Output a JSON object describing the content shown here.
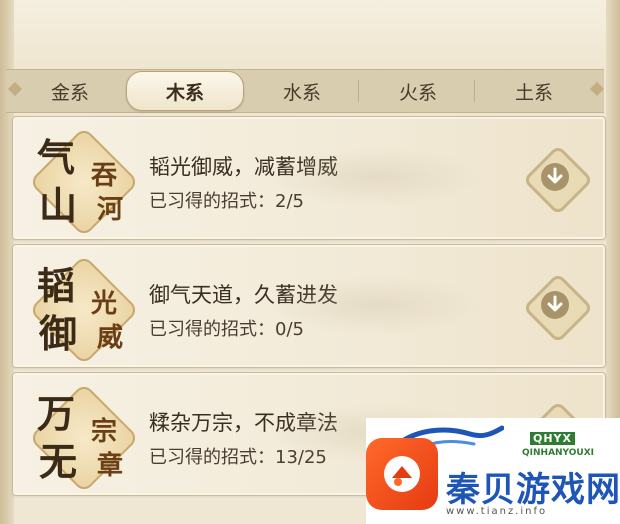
{
  "tabs": [
    {
      "label": "金系",
      "active": false
    },
    {
      "label": "木系",
      "active": true
    },
    {
      "label": "水系",
      "active": false
    },
    {
      "label": "火系",
      "active": false
    },
    {
      "label": "土系",
      "active": false
    }
  ],
  "skills": [
    {
      "emblem": [
        "气",
        "山",
        "吞",
        "河"
      ],
      "title": "韬光御威，减蓄增威",
      "progress_label": "已习得的招式：",
      "progress": "2/5",
      "icon": "chevron-down-icon"
    },
    {
      "emblem": [
        "韬",
        "御",
        "光",
        "威"
      ],
      "title": "御气天道，久蓄进发",
      "progress_label": "已习得的招式：",
      "progress": "0/5",
      "icon": "chevron-down-icon"
    },
    {
      "emblem": [
        "万",
        "无",
        "宗",
        "章"
      ],
      "title": "糅杂万宗，不成章法",
      "progress_label": "已习得的招式：",
      "progress": "13/25",
      "icon": "chevron-down-icon"
    }
  ],
  "watermark": {
    "name": "秦贝游戏网",
    "badge": "QHYX",
    "sub": "QINHANYOUXI",
    "url": "www.tianz.info"
  },
  "colors": {
    "background": "#efe7d3",
    "tab_bar": "#d9cdb0",
    "text": "#3a2e22",
    "accent": "#a8936a",
    "watermark_blue": "#1e56b8",
    "watermark_orange": "#e63a12"
  }
}
